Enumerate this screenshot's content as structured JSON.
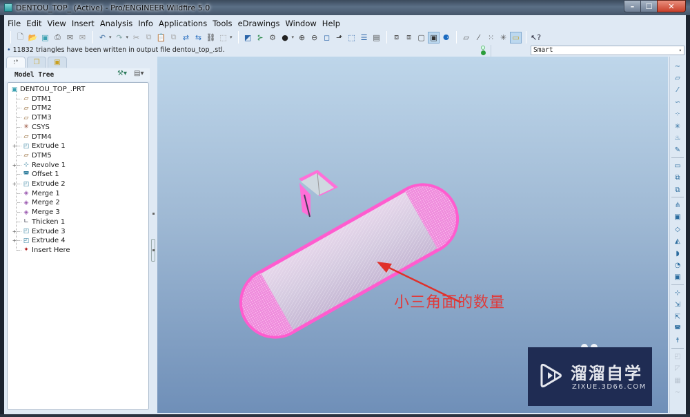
{
  "window": {
    "title": "DENTOU_TOP_ (Active) - Pro/ENGINEER Wildfire 5.0",
    "controls": [
      "minimize",
      "maximize",
      "close"
    ]
  },
  "menu": [
    {
      "label": "File",
      "mnemonic": "F"
    },
    {
      "label": "Edit",
      "mnemonic": "E"
    },
    {
      "label": "View",
      "mnemonic": "V"
    },
    {
      "label": "Insert",
      "mnemonic": "I"
    },
    {
      "label": "Analysis",
      "mnemonic": "A"
    },
    {
      "label": "Info",
      "mnemonic": "n"
    },
    {
      "label": "Applications",
      "mnemonic": "p"
    },
    {
      "label": "Tools",
      "mnemonic": "T"
    },
    {
      "label": "eDrawings",
      "mnemonic": ""
    },
    {
      "label": "Window",
      "mnemonic": "W"
    },
    {
      "label": "Help",
      "mnemonic": "H"
    }
  ],
  "toolbar": {
    "groups": [
      [
        "new-icon",
        "open-icon",
        "save-icon",
        "print-icon",
        "email-icon",
        "email-link-icon"
      ],
      [
        "undo-icon",
        "redo-icon",
        "cut-icon",
        "copy-icon",
        "paste-icon",
        "paste-special-icon",
        "regenerate-icon",
        "regen-manager-icon",
        "find-icon",
        "select-box-icon"
      ],
      [
        "repaint-icon",
        "spin-center-icon",
        "orient-icon",
        "appearance-icon",
        "zoom-in-icon",
        "zoom-out-icon",
        "refit-icon",
        "reorient-icon",
        "saved-views-icon",
        "layers-icon",
        "view-manager-icon"
      ],
      [
        "wireframe-icon",
        "hidden-line-icon",
        "no-hidden-icon",
        "shading-icon",
        "enhanced-realism-icon"
      ],
      [
        "datum-planes-icon",
        "datum-axes-icon",
        "datum-points-icon",
        "csys-icon",
        "annotations-icon"
      ],
      [
        "context-help-icon"
      ]
    ]
  },
  "message": "11832 triangles have been written in output file dentou_top_.stl.",
  "filter": {
    "selected": "Smart"
  },
  "navigator": {
    "tabs": [
      "model-tree-tab",
      "folder-browser-tab",
      "favorites-tab"
    ],
    "title": "Model Tree"
  },
  "tree": [
    {
      "label": "DENTOU_TOP_.PRT",
      "icon": "part-icon",
      "expandable": false,
      "root": true
    },
    {
      "label": "DTM1",
      "icon": "datum-plane-icon",
      "expandable": false
    },
    {
      "label": "DTM2",
      "icon": "datum-plane-icon",
      "expandable": false
    },
    {
      "label": "DTM3",
      "icon": "datum-plane-icon",
      "expandable": false
    },
    {
      "label": "CSYS",
      "icon": "csys-icon",
      "expandable": false
    },
    {
      "label": "DTM4",
      "icon": "datum-plane-icon",
      "expandable": false
    },
    {
      "label": "Extrude 1",
      "icon": "extrude-icon",
      "expandable": true
    },
    {
      "label": "DTM5",
      "icon": "datum-plane-icon",
      "expandable": false
    },
    {
      "label": "Revolve 1",
      "icon": "revolve-icon",
      "expandable": true
    },
    {
      "label": "Offset 1",
      "icon": "offset-icon",
      "expandable": false
    },
    {
      "label": "Extrude 2",
      "icon": "extrude-icon",
      "expandable": true
    },
    {
      "label": "Merge 1",
      "icon": "merge-icon",
      "expandable": false
    },
    {
      "label": "Merge 2",
      "icon": "merge-icon",
      "expandable": false
    },
    {
      "label": "Merge 3",
      "icon": "merge-icon",
      "expandable": false
    },
    {
      "label": "Thicken 1",
      "icon": "thicken-icon",
      "expandable": false
    },
    {
      "label": "Extrude 3",
      "icon": "extrude-icon",
      "expandable": true
    },
    {
      "label": "Extrude 4",
      "icon": "extrude-icon",
      "expandable": true
    },
    {
      "label": "Insert Here",
      "icon": "insert-here-icon",
      "expandable": false
    }
  ],
  "annotation": {
    "text": "小三角面的数量",
    "color": "#e03a3a"
  },
  "model": {
    "mesh_color": "#ff5ccf",
    "body_color": "#d9cfe0"
  },
  "watermark": {
    "title": "溜溜自学",
    "url": "ZIXUE.3D66.COM"
  },
  "right_toolbar": {
    "groups": [
      [
        "sketched-curve-icon",
        "datum-plane-tool-icon",
        "datum-axis-tool-icon",
        "datum-curve-icon",
        "datum-point-tool-icon",
        "csys-tool-icon",
        "analysis-feature-icon",
        "insert-datum-icon"
      ],
      [
        "feature-tool-1-icon",
        "feature-tool-2-icon",
        "feature-tool-3-icon"
      ],
      [
        "extrude-tool-icon",
        "revolve-tool-icon",
        "sweep-tool-icon",
        "variable-sweep-icon",
        "blend-tool-icon",
        "helical-sweep-icon",
        "boundary-blend-icon"
      ],
      [
        "hole-tool-icon",
        "shell-tool-icon",
        "rib-tool-icon",
        "draft-tool-icon",
        "round-tool-icon"
      ],
      [
        "pattern-disabled-icon",
        "mirror-disabled-icon",
        "trim-disabled-icon",
        "grid-disabled-icon"
      ]
    ]
  }
}
